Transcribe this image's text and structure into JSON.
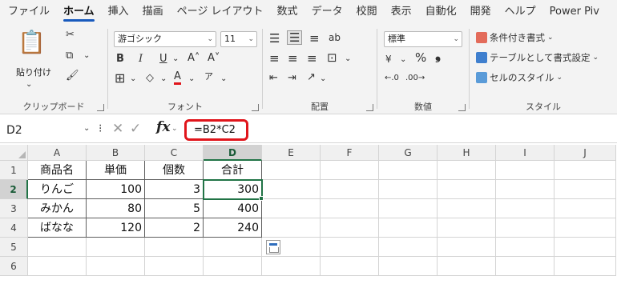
{
  "ribbon_tabs": [
    "ファイル",
    "ホーム",
    "挿入",
    "描画",
    "ページ レイアウト",
    "数式",
    "データ",
    "校閲",
    "表示",
    "自動化",
    "開発",
    "ヘルプ",
    "Power Piv"
  ],
  "active_tab": "ホーム",
  "clipboard": {
    "paste_label": "貼り付け",
    "group_label": "クリップボード"
  },
  "font": {
    "name": "游ゴシック",
    "size": "11",
    "group_label": "フォント",
    "bold": "B",
    "italic": "I",
    "underline": "U",
    "font_color_glyph": "A"
  },
  "alignment": {
    "group_label": "配置"
  },
  "number": {
    "format": "標準",
    "percent": "%",
    "comma": "❟",
    "group_label": "数値"
  },
  "styles": {
    "conditional_formatting": "条件付き書式",
    "format_as_table": "テーブルとして書式設定",
    "cell_styles": "セルのスタイル",
    "group_label": "スタイル"
  },
  "formula_bar": {
    "name_box": "D2",
    "fx": "fx",
    "formula": "=B2*C2"
  },
  "columns": [
    "A",
    "B",
    "C",
    "D",
    "E",
    "F",
    "G",
    "H",
    "I",
    "J"
  ],
  "rows": [
    "1",
    "2",
    "3",
    "4",
    "5",
    "6"
  ],
  "table": {
    "headers": [
      "商品名",
      "単価",
      "個数",
      "合計"
    ],
    "rows": [
      [
        "りんご",
        "100",
        "3",
        "300"
      ],
      [
        "みかん",
        "80",
        "5",
        "400"
      ],
      [
        "ばなな",
        "120",
        "2",
        "240"
      ]
    ]
  },
  "active_cell": "D2",
  "colors": {
    "accent": "#217346",
    "tab_underline": "#185abd",
    "formula_highlight": "#e0151b"
  }
}
